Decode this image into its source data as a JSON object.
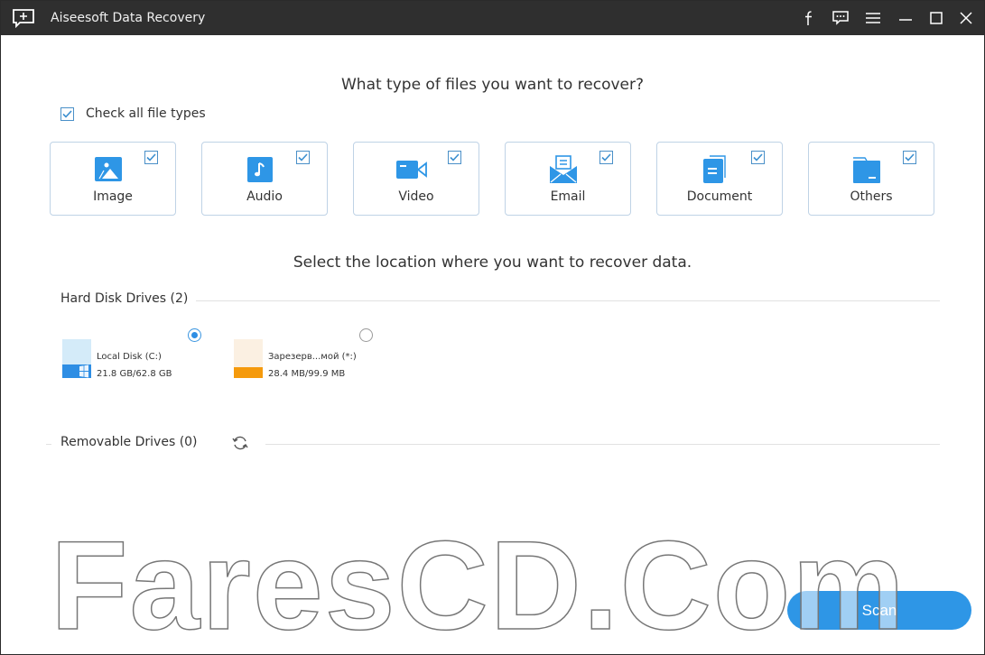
{
  "window": {
    "title": "Aiseesoft Data Recovery",
    "app_icon": "feedback-plus-icon",
    "controls": [
      {
        "name": "facebook",
        "icon": "facebook-icon"
      },
      {
        "name": "feedback",
        "icon": "chat-icon"
      },
      {
        "name": "menu",
        "icon": "menu-icon"
      },
      {
        "name": "minimize",
        "icon": "minimize-icon"
      },
      {
        "name": "maximize",
        "icon": "maximize-icon"
      },
      {
        "name": "close",
        "icon": "close-icon"
      }
    ]
  },
  "file_types": {
    "question": "What type of files you want to recover?",
    "check_all_label": "Check all file types",
    "check_all_checked": true,
    "items": [
      {
        "label": "Image",
        "icon": "image-icon",
        "checked": true
      },
      {
        "label": "Audio",
        "icon": "music-note-icon",
        "checked": true
      },
      {
        "label": "Video",
        "icon": "video-camera-icon",
        "checked": true
      },
      {
        "label": "Email",
        "icon": "envelope-icon",
        "checked": true
      },
      {
        "label": "Document",
        "icon": "document-icon",
        "checked": true
      },
      {
        "label": "Others",
        "icon": "folder-icon",
        "checked": true
      }
    ]
  },
  "location": {
    "question": "Select the location where you want to recover data.",
    "hard_disks": {
      "heading": "Hard Disk Drives (2)",
      "drives": [
        {
          "name": "Local Disk (C:)",
          "size": "21.8 GB/62.8 GB",
          "selected": true,
          "used_fraction": 0.35,
          "color": "#2e8ee4",
          "light_color": "#d4ebf9",
          "icon": "windows-disk-icon"
        },
        {
          "name": "Зарезерв...мой (*:)",
          "size": "28.4 MB/99.9 MB",
          "selected": false,
          "used_fraction": 0.28,
          "color": "#f59a0c",
          "light_color": "#fbf0e2",
          "icon": "disk-icon"
        }
      ]
    },
    "removable": {
      "heading": "Removable Drives (0)",
      "refresh_icon": "refresh-icon"
    }
  },
  "actions": {
    "scan_label": "Scan"
  },
  "watermark": "FaresCD.Com",
  "colors": {
    "accent": "#2e96e6",
    "titlebar": "#2f2f2f",
    "card_border": "#bfd3e6"
  }
}
